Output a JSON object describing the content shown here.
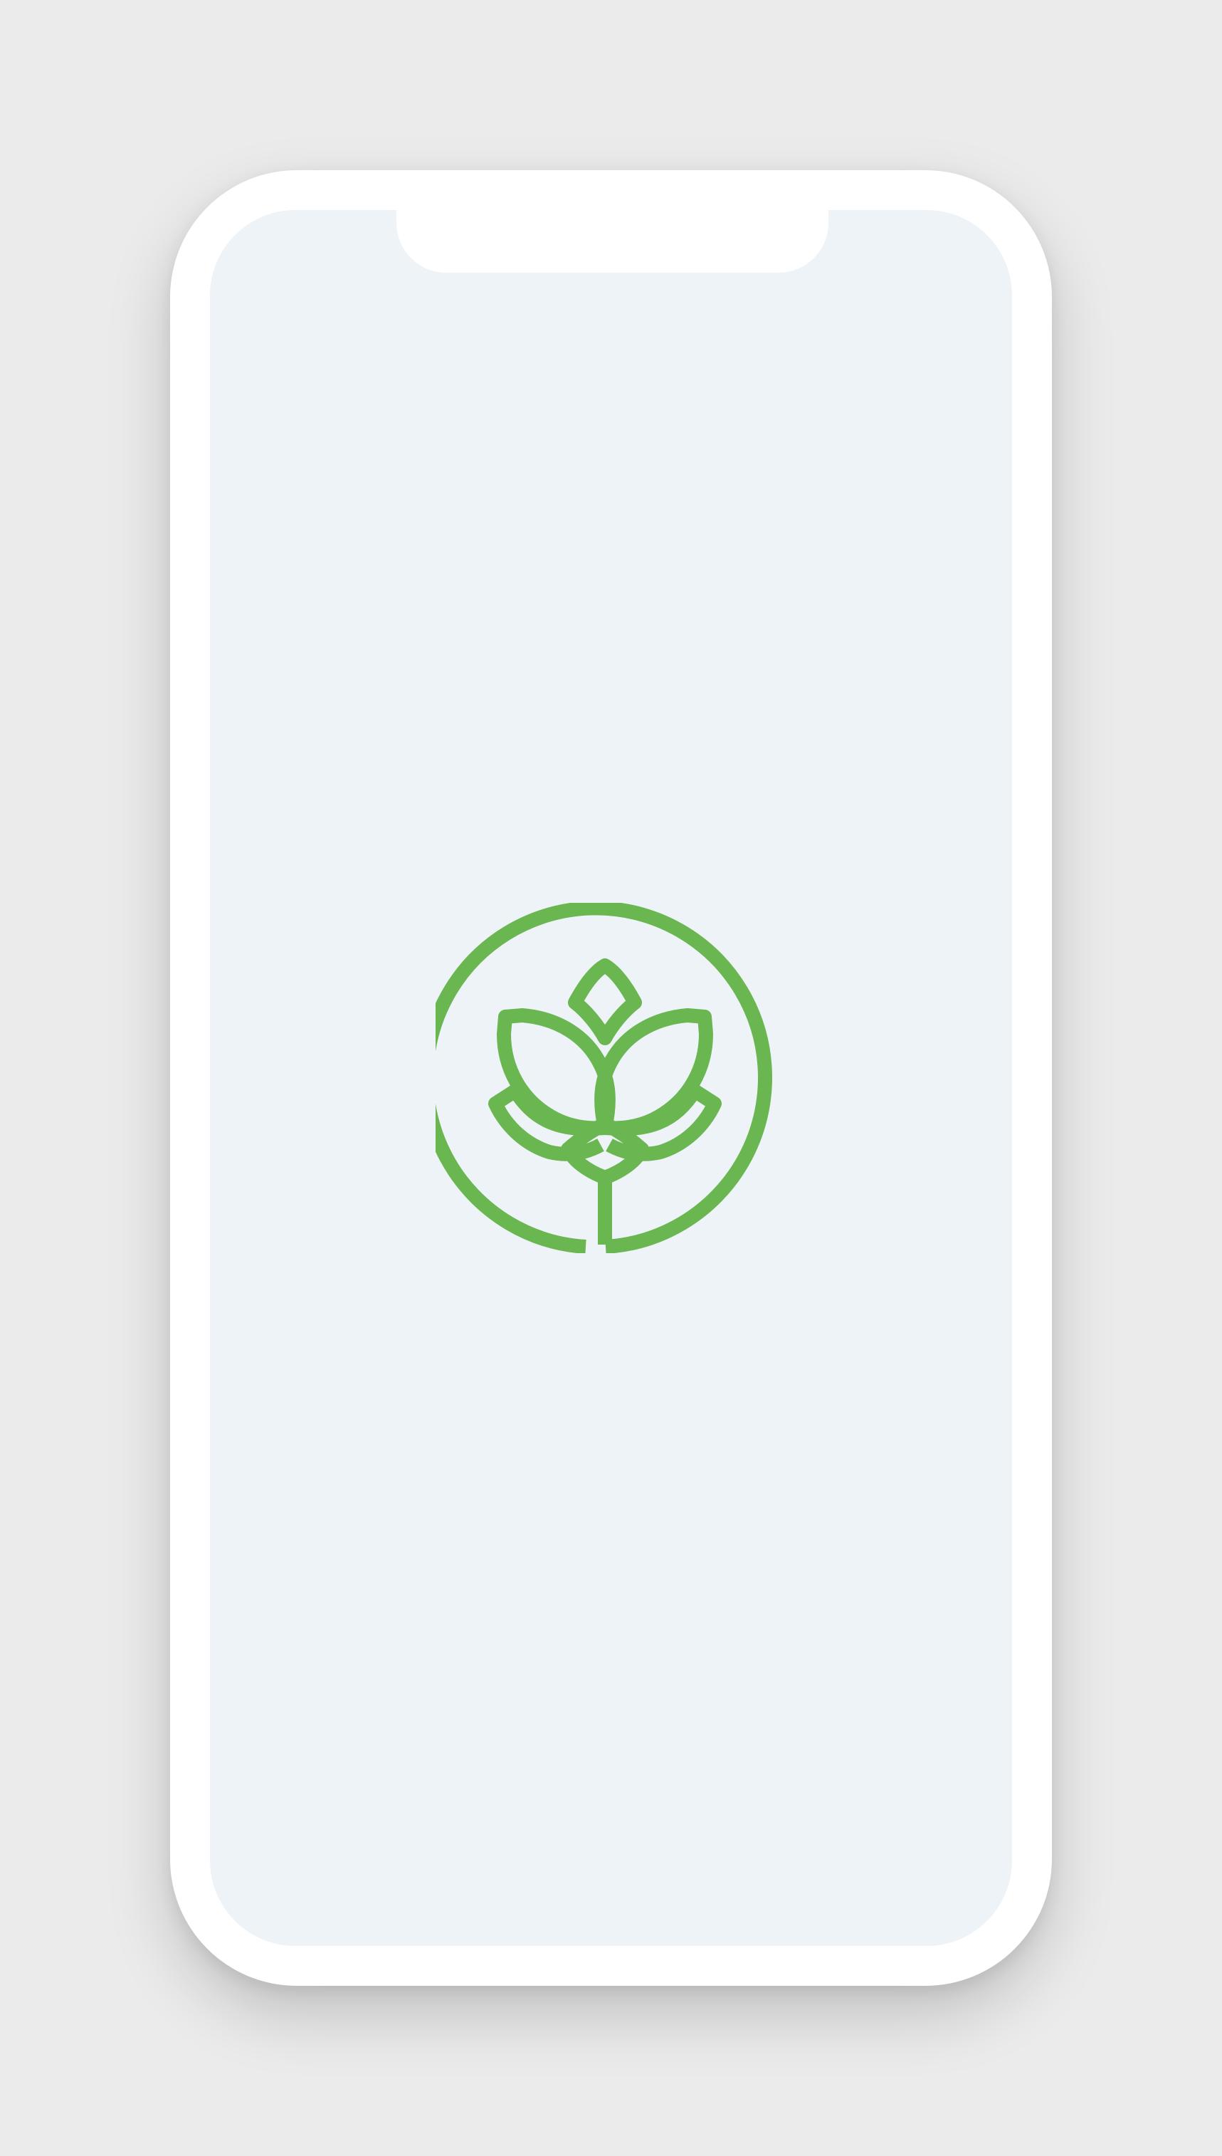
{
  "device": {
    "frame_color": "#ffffff",
    "screen_color": "#eef3f7",
    "background_color": "#ebebeb"
  },
  "splash": {
    "logo": {
      "icon": "lotus-flower-icon",
      "color": "#6ab651"
    }
  }
}
